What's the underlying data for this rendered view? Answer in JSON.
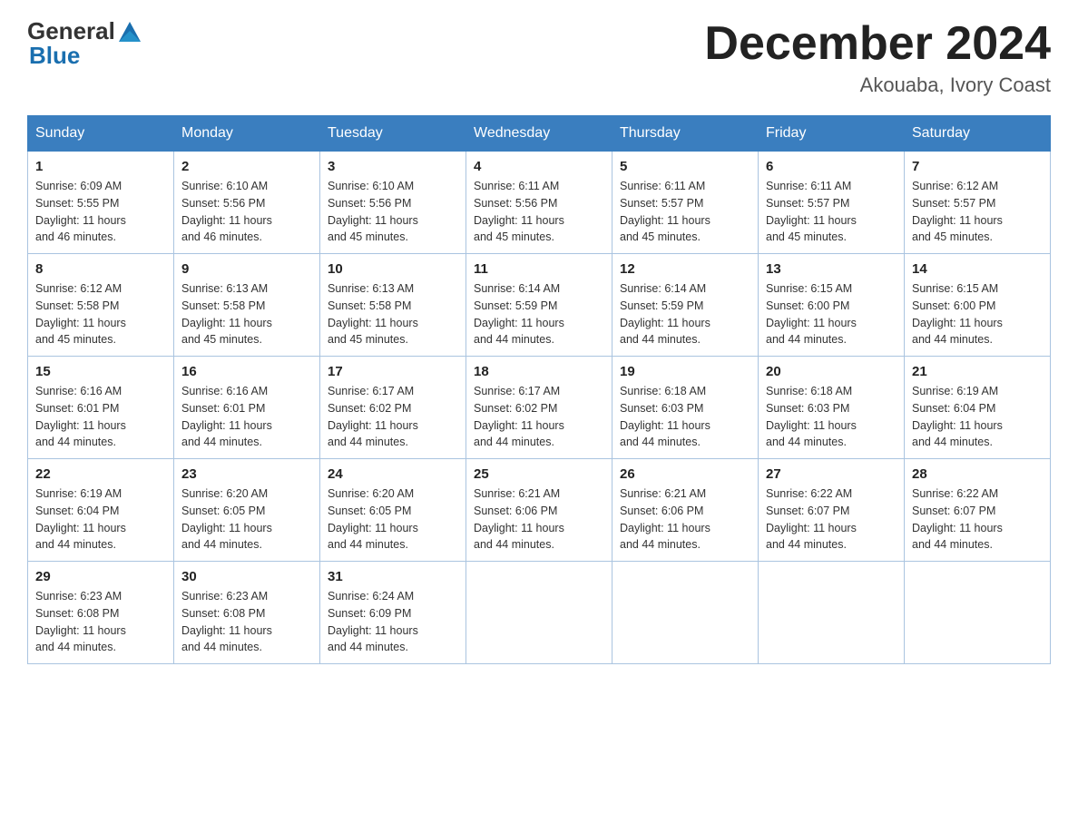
{
  "header": {
    "logo_general": "General",
    "logo_blue": "Blue",
    "month_title": "December 2024",
    "location": "Akouaba, Ivory Coast"
  },
  "weekdays": [
    "Sunday",
    "Monday",
    "Tuesday",
    "Wednesday",
    "Thursday",
    "Friday",
    "Saturday"
  ],
  "weeks": [
    [
      {
        "day": "1",
        "sunrise": "6:09 AM",
        "sunset": "5:55 PM",
        "daylight": "11 hours and 46 minutes."
      },
      {
        "day": "2",
        "sunrise": "6:10 AM",
        "sunset": "5:56 PM",
        "daylight": "11 hours and 46 minutes."
      },
      {
        "day": "3",
        "sunrise": "6:10 AM",
        "sunset": "5:56 PM",
        "daylight": "11 hours and 45 minutes."
      },
      {
        "day": "4",
        "sunrise": "6:11 AM",
        "sunset": "5:56 PM",
        "daylight": "11 hours and 45 minutes."
      },
      {
        "day": "5",
        "sunrise": "6:11 AM",
        "sunset": "5:57 PM",
        "daylight": "11 hours and 45 minutes."
      },
      {
        "day": "6",
        "sunrise": "6:11 AM",
        "sunset": "5:57 PM",
        "daylight": "11 hours and 45 minutes."
      },
      {
        "day": "7",
        "sunrise": "6:12 AM",
        "sunset": "5:57 PM",
        "daylight": "11 hours and 45 minutes."
      }
    ],
    [
      {
        "day": "8",
        "sunrise": "6:12 AM",
        "sunset": "5:58 PM",
        "daylight": "11 hours and 45 minutes."
      },
      {
        "day": "9",
        "sunrise": "6:13 AM",
        "sunset": "5:58 PM",
        "daylight": "11 hours and 45 minutes."
      },
      {
        "day": "10",
        "sunrise": "6:13 AM",
        "sunset": "5:58 PM",
        "daylight": "11 hours and 45 minutes."
      },
      {
        "day": "11",
        "sunrise": "6:14 AM",
        "sunset": "5:59 PM",
        "daylight": "11 hours and 44 minutes."
      },
      {
        "day": "12",
        "sunrise": "6:14 AM",
        "sunset": "5:59 PM",
        "daylight": "11 hours and 44 minutes."
      },
      {
        "day": "13",
        "sunrise": "6:15 AM",
        "sunset": "6:00 PM",
        "daylight": "11 hours and 44 minutes."
      },
      {
        "day": "14",
        "sunrise": "6:15 AM",
        "sunset": "6:00 PM",
        "daylight": "11 hours and 44 minutes."
      }
    ],
    [
      {
        "day": "15",
        "sunrise": "6:16 AM",
        "sunset": "6:01 PM",
        "daylight": "11 hours and 44 minutes."
      },
      {
        "day": "16",
        "sunrise": "6:16 AM",
        "sunset": "6:01 PM",
        "daylight": "11 hours and 44 minutes."
      },
      {
        "day": "17",
        "sunrise": "6:17 AM",
        "sunset": "6:02 PM",
        "daylight": "11 hours and 44 minutes."
      },
      {
        "day": "18",
        "sunrise": "6:17 AM",
        "sunset": "6:02 PM",
        "daylight": "11 hours and 44 minutes."
      },
      {
        "day": "19",
        "sunrise": "6:18 AM",
        "sunset": "6:03 PM",
        "daylight": "11 hours and 44 minutes."
      },
      {
        "day": "20",
        "sunrise": "6:18 AM",
        "sunset": "6:03 PM",
        "daylight": "11 hours and 44 minutes."
      },
      {
        "day": "21",
        "sunrise": "6:19 AM",
        "sunset": "6:04 PM",
        "daylight": "11 hours and 44 minutes."
      }
    ],
    [
      {
        "day": "22",
        "sunrise": "6:19 AM",
        "sunset": "6:04 PM",
        "daylight": "11 hours and 44 minutes."
      },
      {
        "day": "23",
        "sunrise": "6:20 AM",
        "sunset": "6:05 PM",
        "daylight": "11 hours and 44 minutes."
      },
      {
        "day": "24",
        "sunrise": "6:20 AM",
        "sunset": "6:05 PM",
        "daylight": "11 hours and 44 minutes."
      },
      {
        "day": "25",
        "sunrise": "6:21 AM",
        "sunset": "6:06 PM",
        "daylight": "11 hours and 44 minutes."
      },
      {
        "day": "26",
        "sunrise": "6:21 AM",
        "sunset": "6:06 PM",
        "daylight": "11 hours and 44 minutes."
      },
      {
        "day": "27",
        "sunrise": "6:22 AM",
        "sunset": "6:07 PM",
        "daylight": "11 hours and 44 minutes."
      },
      {
        "day": "28",
        "sunrise": "6:22 AM",
        "sunset": "6:07 PM",
        "daylight": "11 hours and 44 minutes."
      }
    ],
    [
      {
        "day": "29",
        "sunrise": "6:23 AM",
        "sunset": "6:08 PM",
        "daylight": "11 hours and 44 minutes."
      },
      {
        "day": "30",
        "sunrise": "6:23 AM",
        "sunset": "6:08 PM",
        "daylight": "11 hours and 44 minutes."
      },
      {
        "day": "31",
        "sunrise": "6:24 AM",
        "sunset": "6:09 PM",
        "daylight": "11 hours and 44 minutes."
      },
      null,
      null,
      null,
      null
    ]
  ],
  "labels": {
    "sunrise": "Sunrise:",
    "sunset": "Sunset:",
    "daylight": "Daylight:"
  }
}
